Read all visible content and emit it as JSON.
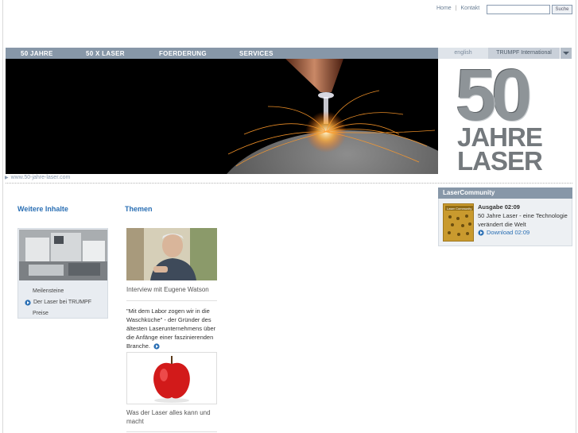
{
  "header": {
    "links": [
      "Home",
      "Kontakt"
    ],
    "separator": "|",
    "search": {
      "placeholder": "",
      "button_label": "Suche"
    }
  },
  "nav": {
    "items": [
      "50 JAHRE",
      "50 X LASER",
      "FOERDERUNG",
      "SERVICES"
    ],
    "language": "english",
    "international": "TRUMPF International"
  },
  "badge": {
    "number": "50",
    "line1": "JAHRE",
    "line2": "LASER"
  },
  "hero_caption": "www.50-jahre-laser.com",
  "weitere": {
    "title": "Weitere Inhalte",
    "links": [
      "Meilensteine",
      "Der Laser bei TRUMPF",
      "Preise"
    ]
  },
  "themen": {
    "title": "Themen",
    "interview_caption": "Interview mit Eugene Watson",
    "quote": "\"Mit dem Labor zogen wir in die Waschküche\" - der Gründer des ältesten Laserunternehmens über die Anfänge einer faszinierenden Branche.",
    "apple_caption": "Was der Laser alles kann und macht"
  },
  "community": {
    "title": "LaserCommunity",
    "cover_label": "Laser Community",
    "issue": "Ausgabe 02:09",
    "description": "50 Jahre Laser - eine Technologie verändert die Welt",
    "download": "Download 02:09"
  },
  "colors": {
    "nav": "#8797a8",
    "link_blue": "#2a6fb4",
    "panel": "#edf0f3"
  }
}
